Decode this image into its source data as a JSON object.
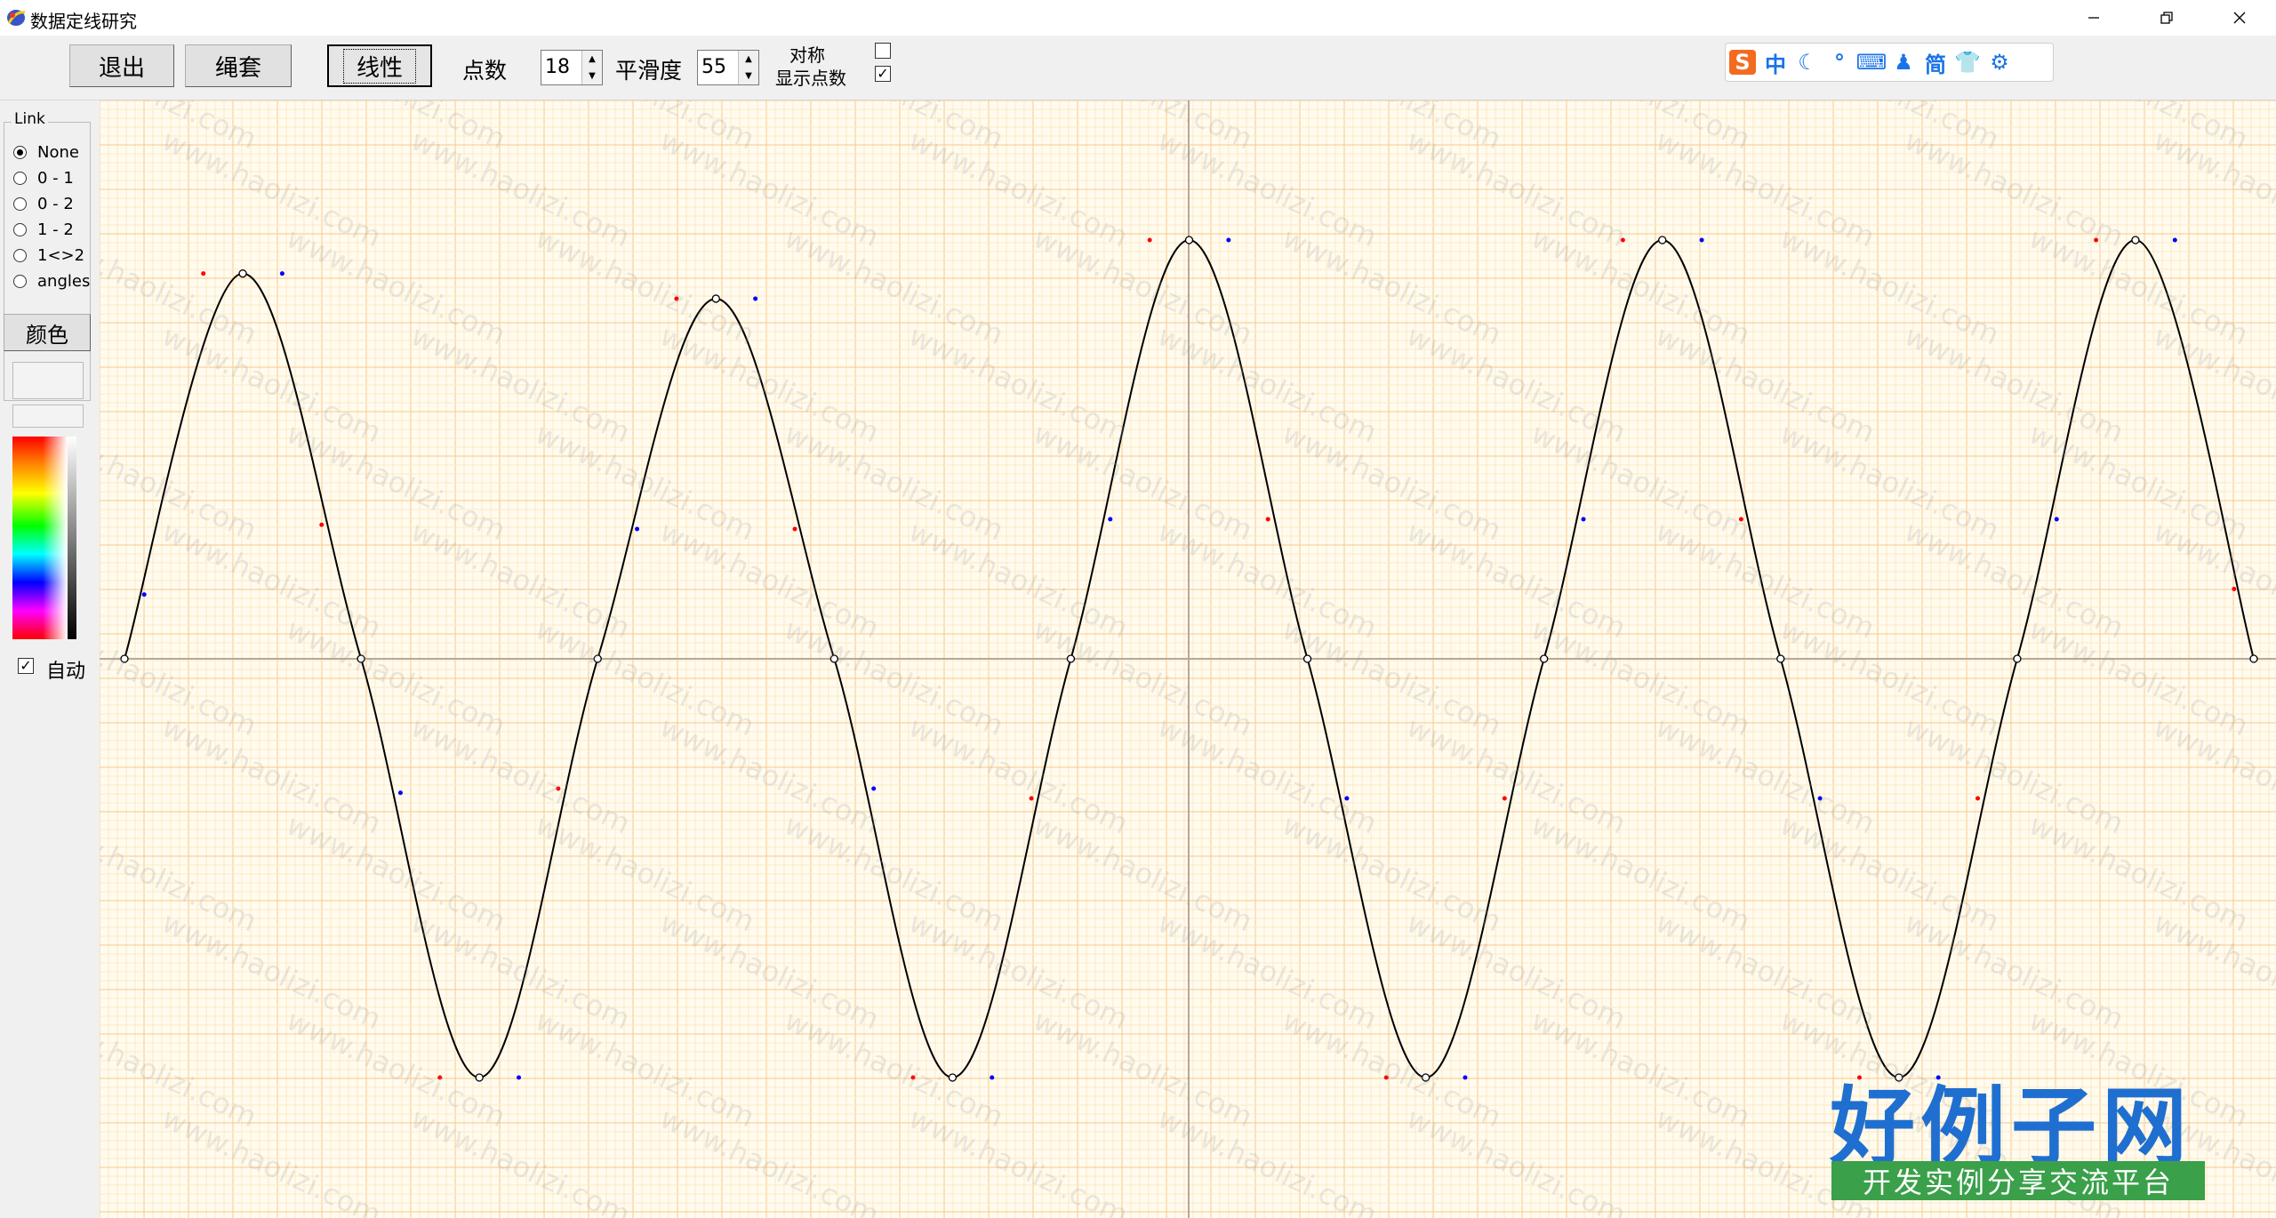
{
  "window": {
    "title": "数据定线研究",
    "minimize_icon": "minimize-icon",
    "restore_icon": "restore-icon",
    "close_icon": "close-icon"
  },
  "toolbar": {
    "exit_label": "退出",
    "rope_label": "绳套",
    "linear_label": "线性",
    "points_label": "点数",
    "points_value": "18",
    "smooth_label": "平滑度",
    "smooth_value": "55",
    "symmetric_label": "对称",
    "show_points_label": "显示点数",
    "symmetric_checked": false,
    "show_points_checked": true
  },
  "ime_bar": {
    "items": [
      "S",
      "中",
      "☾",
      "°",
      "⌨",
      "♟",
      "简",
      "👕",
      "⚙"
    ]
  },
  "sidebar": {
    "link_group_title": "Link",
    "link_options": [
      "None",
      "0 - 1",
      "0 - 2",
      "1 - 2",
      "1<>2",
      "angles"
    ],
    "selected_link": "None",
    "color_button_label": "颜色",
    "auto_label": "自动",
    "auto_checked": true
  },
  "plot": {
    "watermark_text": "www.haolizi.com",
    "curve_color": "#000000",
    "grid_minor_color": "#fde8c4",
    "grid_major_color": "#f7c98a",
    "axis_color": "#b8a89a",
    "left_handle_color": "#ff0000",
    "right_handle_color": "#0000ff",
    "samples": 18,
    "peak_values": [
      0.92,
      0.86,
      1.0,
      1.0,
      1.0
    ],
    "trough_value": -1.0
  },
  "brand": {
    "title": "好例子网",
    "subtitle": "开发实例分享交流平台"
  }
}
